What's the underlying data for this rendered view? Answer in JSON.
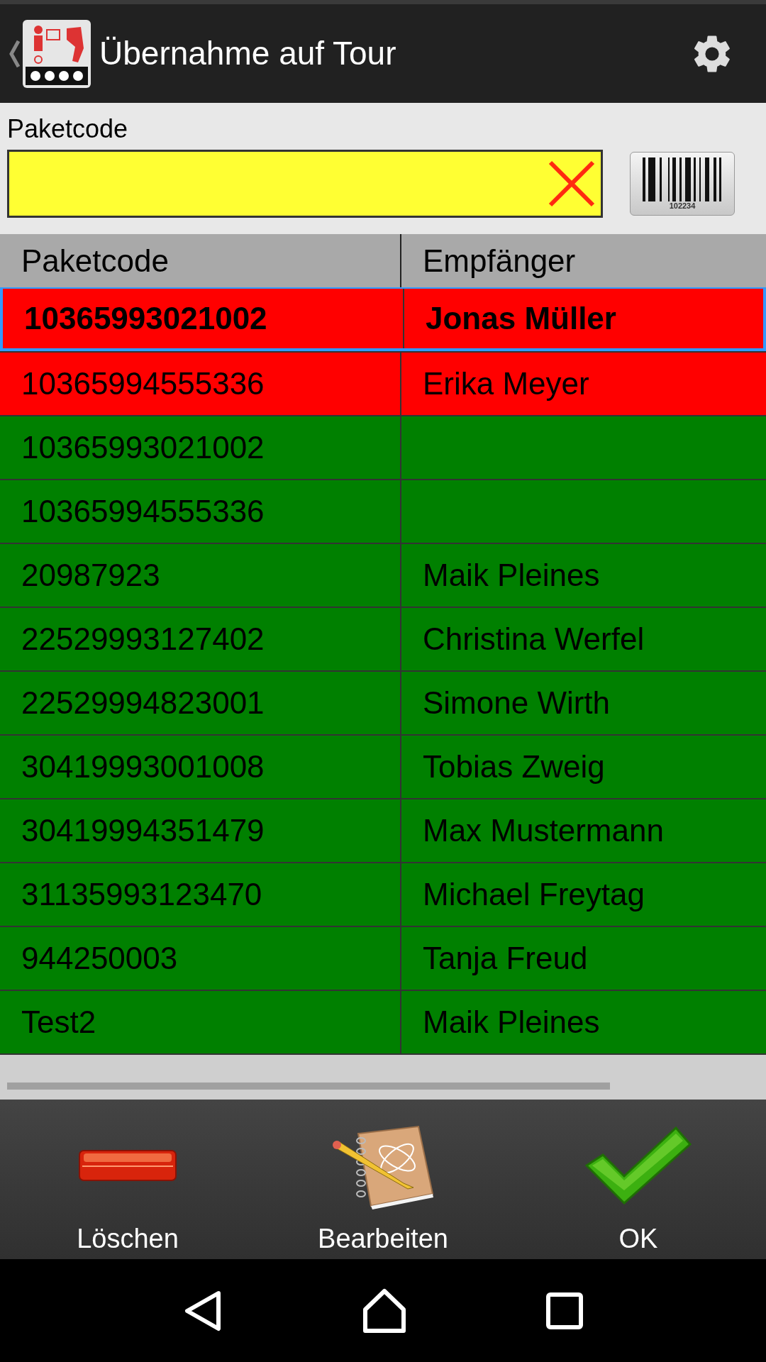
{
  "app_bar": {
    "title": "Übernahme auf Tour"
  },
  "scan": {
    "label": "Paketcode",
    "barcode_caption": "102234"
  },
  "table": {
    "columns": [
      "Paketcode",
      "Empfänger"
    ],
    "rows": [
      {
        "cells": [
          "10365993021002",
          "Jonas Müller"
        ],
        "color": "#ff0000",
        "selected": true
      },
      {
        "cells": [
          "10365994555336",
          "Erika Meyer"
        ],
        "color": "#ff0000",
        "selected": false
      },
      {
        "cells": [
          "10365993021002",
          ""
        ],
        "color": "#008000",
        "selected": false
      },
      {
        "cells": [
          "10365994555336",
          ""
        ],
        "color": "#008000",
        "selected": false
      },
      {
        "cells": [
          "20987923",
          "Maik Pleines"
        ],
        "color": "#008000",
        "selected": false
      },
      {
        "cells": [
          "22529993127402",
          "Christina Werfel"
        ],
        "color": "#008000",
        "selected": false
      },
      {
        "cells": [
          "22529994823001",
          "Simone Wirth"
        ],
        "color": "#008000",
        "selected": false
      },
      {
        "cells": [
          "30419993001008",
          "Tobias Zweig"
        ],
        "color": "#008000",
        "selected": false
      },
      {
        "cells": [
          "30419994351479",
          "Max Mustermann"
        ],
        "color": "#008000",
        "selected": false
      },
      {
        "cells": [
          "31135993123470",
          "Michael Freytag"
        ],
        "color": "#008000",
        "selected": false
      },
      {
        "cells": [
          "944250003",
          "Tanja Freud"
        ],
        "color": "#008000",
        "selected": false
      },
      {
        "cells": [
          "Test2",
          "Maik Pleines"
        ],
        "color": "#008000",
        "selected": false
      }
    ]
  },
  "toolbar": [
    {
      "kind": "delete",
      "label": "Löschen"
    },
    {
      "kind": "edit",
      "label": "Bearbeiten"
    },
    {
      "kind": "ok",
      "label": "OK"
    }
  ]
}
